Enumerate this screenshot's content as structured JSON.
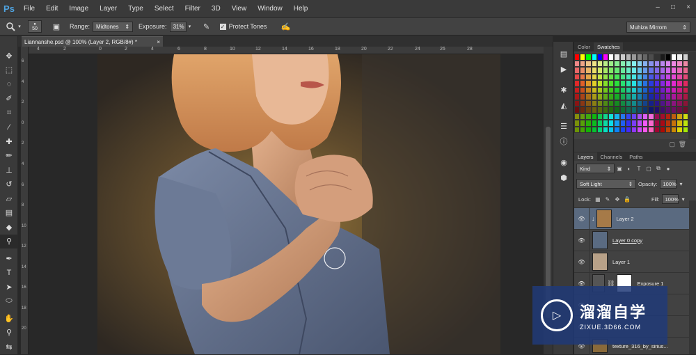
{
  "app": {
    "logo": "Ps"
  },
  "menu": [
    "File",
    "Edit",
    "Image",
    "Layer",
    "Type",
    "Select",
    "Filter",
    "3D",
    "View",
    "Window",
    "Help"
  ],
  "window_controls": [
    "–",
    "□",
    "×"
  ],
  "options": {
    "brush_size": "50",
    "range_label": "Range:",
    "range_value": "Midtones",
    "exposure_label": "Exposure:",
    "exposure_value": "31%",
    "protect_tones_label": "Protect Tones",
    "protect_tones_checked": true,
    "workspace": "Muhiza Mirrom"
  },
  "document": {
    "tab_title": "Liannanshe.psd @ 100% (Layer 2, RGB/8#) *",
    "close": "×"
  },
  "ruler": {
    "top": [
      "4",
      "2",
      "0",
      "2",
      "4",
      "6",
      "8",
      "10",
      "12",
      "14",
      "16",
      "18",
      "20",
      "22",
      "24",
      "26",
      "28"
    ],
    "left": [
      "6",
      "4",
      "2",
      "0",
      "2",
      "4",
      "6",
      "8",
      "10",
      "12",
      "14",
      "16",
      "18",
      "20"
    ]
  },
  "panels": {
    "color_tab": "Color",
    "swatches_tab": "Swatches",
    "layers_tab": "Layers",
    "channels_tab": "Channels",
    "paths_tab": "Paths",
    "kind_value": "Kind",
    "blend_mode": "Soft Light",
    "opacity_label": "Opacity:",
    "opacity_value": "100%",
    "lock_label": "Lock:",
    "fill_label": "Fill:",
    "fill_value": "100%"
  },
  "layers": [
    {
      "name": "Layer 2",
      "selected": true,
      "thumb": "#a67a48"
    },
    {
      "name": "Layer 0 copy",
      "selected": false,
      "thumb": "#5a6b82"
    },
    {
      "name": "Layer 1",
      "selected": false,
      "thumb": "#b8a188"
    },
    {
      "name": "Exposure 1",
      "selected": false,
      "thumb": "#ffffff"
    },
    {
      "name": "texture_316_by_sirius...",
      "selected": false,
      "thumb": "#8a6a3a"
    }
  ],
  "watermark": {
    "cn": "溜溜自学",
    "url": "ZIXUE.3D66.COM"
  },
  "colors": {
    "accent": "#5a6a80",
    "menubar": "#3a3a3a",
    "panel": "#424242"
  }
}
